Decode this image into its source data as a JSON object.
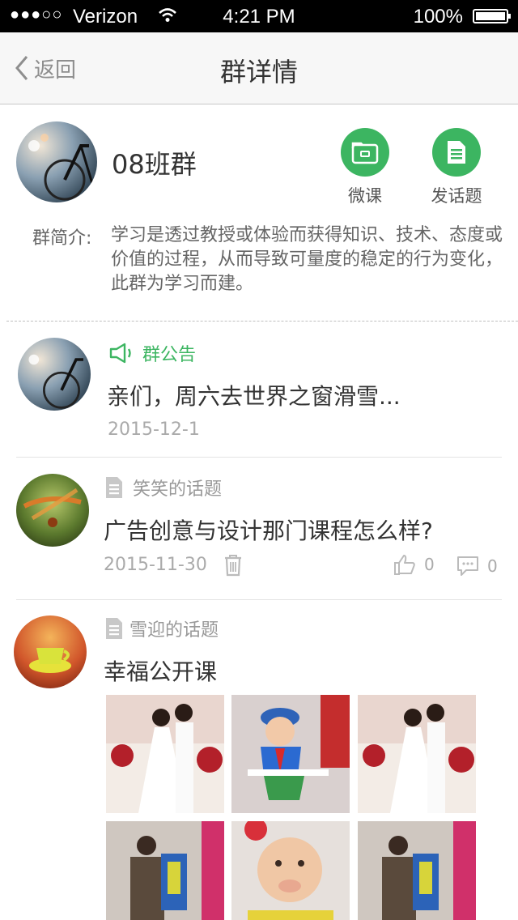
{
  "status_bar": {
    "signal": "●●●○○",
    "carrier": "Verizon",
    "time": "4:21 PM",
    "battery": "100%"
  },
  "nav": {
    "back_label": "返回",
    "title": "群详情"
  },
  "group": {
    "name": "08班群",
    "actions": [
      {
        "label": "微课",
        "icon": "video-card-icon"
      },
      {
        "label": "发话题",
        "icon": "document-icon"
      }
    ],
    "intro_label": "群简介:",
    "intro_text": "学习是透过教授或体验而获得知识、技术、态度或价值的过程，从而导致可量度的稳定的行为变化，此群为学习而建。"
  },
  "colors": {
    "accent": "#3cb561",
    "meta_text": "#aaaaaa"
  },
  "feed": [
    {
      "type_label": "群公告",
      "icon": "speaker-icon",
      "title": "亲们，周六去世界之窗滑雪...",
      "date": "2015-12-1"
    },
    {
      "type_label": "笑笑的话题",
      "icon": "document-icon",
      "title": "广告创意与设计那门课程怎么样?",
      "date": "2015-11-30",
      "likes": "0",
      "comments": "0"
    },
    {
      "type_label": "雪迎的话题",
      "icon": "document-icon",
      "title": "幸福公开课",
      "photos": [
        "wedding-photo",
        "child-photo",
        "wedding-photo",
        "store-photo",
        "baby-photo",
        "store-photo"
      ]
    }
  ]
}
